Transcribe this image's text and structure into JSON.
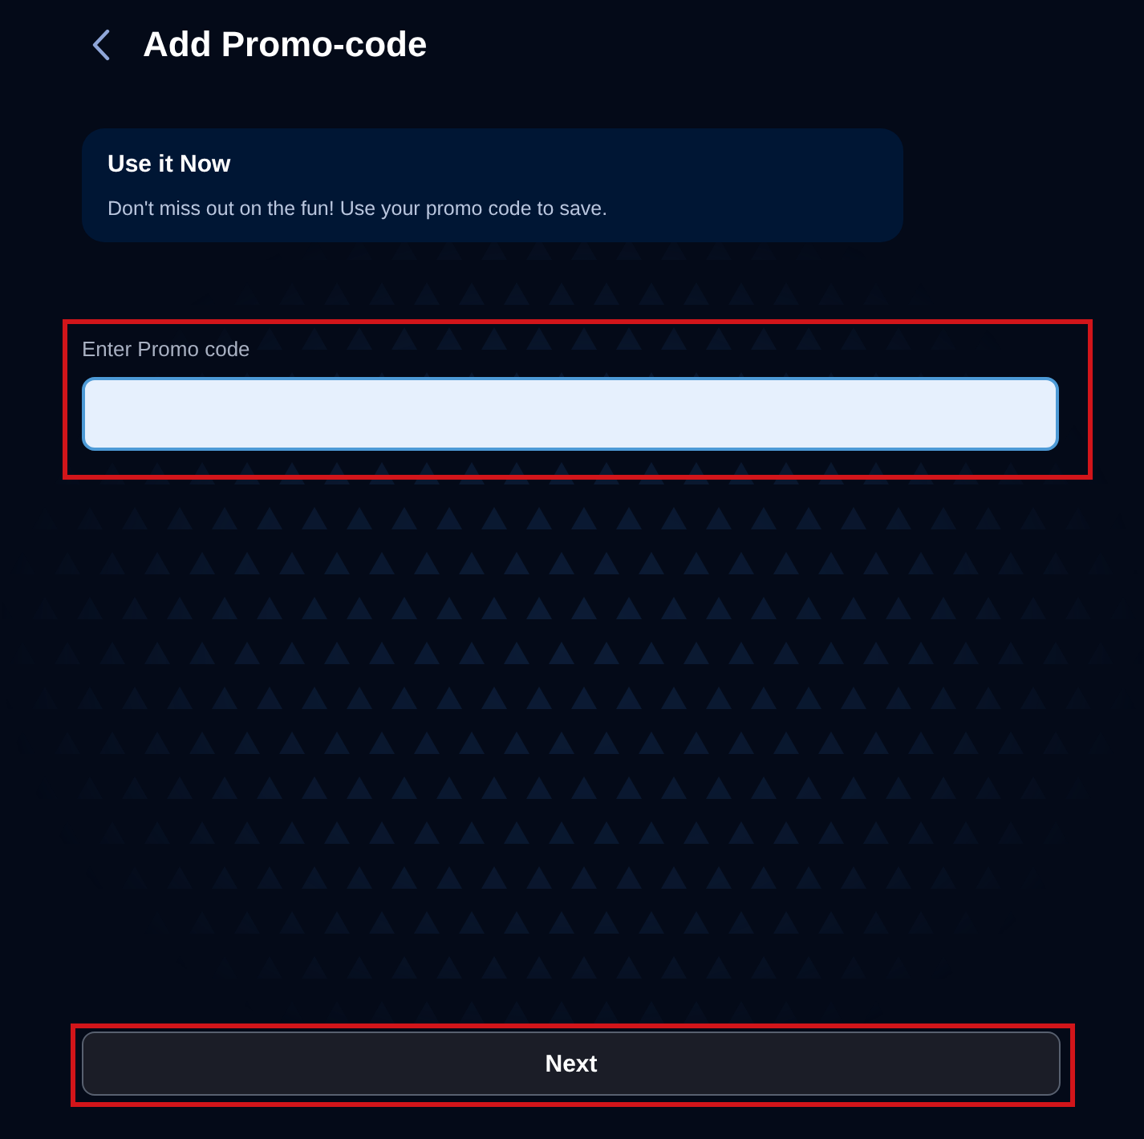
{
  "header": {
    "title": "Add Promo-code"
  },
  "info_card": {
    "title": "Use it Now",
    "text": "Don't miss out on the fun! Use your promo code to save."
  },
  "promo_field": {
    "label": "Enter Promo code",
    "focused": true,
    "highlighted": true
  },
  "next_button": {
    "label": "Next",
    "highlighted": true
  }
}
